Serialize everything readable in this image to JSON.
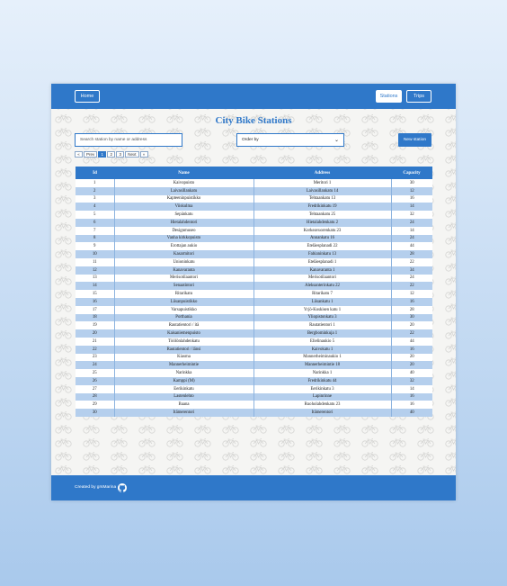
{
  "nav": {
    "home": "Home",
    "stations": "Stations",
    "trips": "Trips"
  },
  "page": {
    "title": "City Bike Stations"
  },
  "controls": {
    "search_placeholder": "Search station by name or address",
    "order_value": "Order by",
    "new_station": "New station"
  },
  "pagination": [
    "«",
    "Prev",
    "1",
    "2",
    "3",
    "Next",
    "»"
  ],
  "pagination_active": "1",
  "table": {
    "headers": [
      "Id",
      "Name",
      "Address",
      "Capacity"
    ],
    "rows": [
      [
        "1",
        "Kaivopuisto",
        "Meritori 1",
        "30"
      ],
      [
        "2",
        "Laivasillankatu",
        "Laivasillankatu 14",
        "12"
      ],
      [
        "3",
        "Kapteeninpuistikko",
        "Tehtaankatu 13",
        "16"
      ],
      [
        "4",
        "Viiskulma",
        "Fredrikinkatu 19",
        "14"
      ],
      [
        "5",
        "Sepänkatu",
        "Tehtaankatu 25",
        "32"
      ],
      [
        "6",
        "Hietalahdentori",
        "Hietalahdenkatu 2",
        "24"
      ],
      [
        "7",
        "Designmuseo",
        "Korkeavuorenkatu 23",
        "14"
      ],
      [
        "8",
        "Vanha kirkkopuisto",
        "Annankatu 16",
        "24"
      ],
      [
        "9",
        "Erottajan aukio",
        "Etelä­esplanadi 22",
        "44"
      ],
      [
        "10",
        "Kasarmitori",
        "Fabianinkatu 13",
        "28"
      ],
      [
        "11",
        "Unioninkatu",
        "Eteläesplanadi 1",
        "22"
      ],
      [
        "12",
        "Kanavaranta",
        "Kanavaranta 1",
        "34"
      ],
      [
        "13",
        "Merisotilaantori",
        "Merisotilaantori",
        "24"
      ],
      [
        "14",
        "Senaatintori",
        "Aleksanterinkatu 22",
        "22"
      ],
      [
        "15",
        "Ritarikatu",
        "Ritarikatu 7",
        "12"
      ],
      [
        "16",
        "Liisanpuistikko",
        "Liisankatu 1",
        "16"
      ],
      [
        "17",
        "Varsapuistikko",
        "Yrjö-Koskisen katu 1",
        "28"
      ],
      [
        "18",
        "Porthania",
        "Yliopistonkatu 3",
        "30"
      ],
      [
        "19",
        "Rautatientori / itä",
        "Rautatientori 1",
        "20"
      ],
      [
        "20",
        "Kaisaniemenpuisto",
        "Bergbominkuja 1",
        "22"
      ],
      [
        "21",
        "Töölönlahdenkatu",
        "Elielinaukio 5",
        "44"
      ],
      [
        "22",
        "Rautatientori / länsi",
        "Kaivokatu 1",
        "16"
      ],
      [
        "23",
        "Kiasma",
        "Mannerheiminaukio 1",
        "20"
      ],
      [
        "24",
        "Mannerheimintie",
        "Mannerheimintie 18",
        "20"
      ],
      [
        "25",
        "Narinkka",
        "Narinkka 1",
        "40"
      ],
      [
        "26",
        "Kamppi (M)",
        "Fredrikinkatu 44",
        "32"
      ],
      [
        "27",
        "Eerikinkatu",
        "Eerikinkatu 3",
        "14"
      ],
      [
        "28",
        "Lastenlehto",
        "Lapinrinne",
        "16"
      ],
      [
        "29",
        "Baana",
        "Ruoholahdenkatu 23",
        "16"
      ],
      [
        "30",
        "Itämerentori",
        "Itämerentori",
        "40"
      ]
    ]
  },
  "footer": {
    "text": "Created by grsMarina",
    "icon": "github-icon"
  },
  "colors": {
    "primary": "#2f78c9",
    "row_alt": "#b5cfed",
    "page_bg_top": "#e6f0fb",
    "page_bg_bottom": "#a9c9ec"
  }
}
